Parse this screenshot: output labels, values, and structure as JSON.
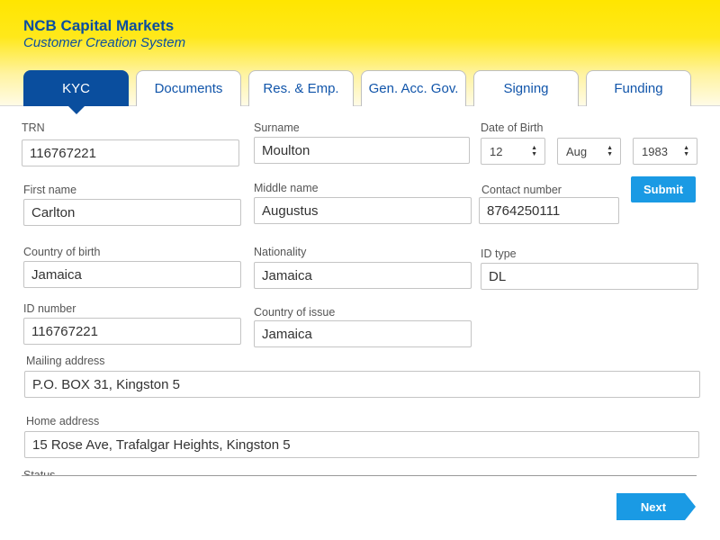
{
  "header": {
    "title": "NCB Capital Markets",
    "subtitle": "Customer Creation System"
  },
  "tabs": [
    {
      "label": "KYC",
      "active": true
    },
    {
      "label": "Documents",
      "active": false
    },
    {
      "label": "Res. & Emp.",
      "active": false
    },
    {
      "label": "Gen. Acc. Gov.",
      "active": false
    },
    {
      "label": "Signing",
      "active": false
    },
    {
      "label": "Funding",
      "active": false
    }
  ],
  "form": {
    "trn": {
      "label": "TRN",
      "value": "116767221"
    },
    "surname": {
      "label": "Surname",
      "value": "Moulton"
    },
    "dob": {
      "label": "Date of Birth",
      "day": "12",
      "month": "Aug",
      "year": "1983"
    },
    "first_name": {
      "label": "First name",
      "value": "Carlton"
    },
    "middle_name": {
      "label": "Middle name",
      "value": "Augustus"
    },
    "contact_number": {
      "label": "Contact number",
      "value": "8764250111"
    },
    "country_of_birth": {
      "label": "Country of birth",
      "value": "Jamaica"
    },
    "nationality": {
      "label": "Nationality",
      "value": "Jamaica"
    },
    "id_type": {
      "label": "ID type",
      "value": "DL"
    },
    "id_number": {
      "label": "ID number",
      "value": "116767221"
    },
    "country_of_issue": {
      "label": "Country of issue",
      "value": "Jamaica"
    },
    "mailing_address": {
      "label": "Mailing address",
      "value": "P.O. BOX 31, Kingston 5"
    },
    "home_address": {
      "label": "Home address",
      "value": "15 Rose Ave, Trafalgar Heights, Kingston 5"
    },
    "status_partial": {
      "label": "Status"
    }
  },
  "actions": {
    "submit_label": "Submit",
    "next_label": "Next"
  },
  "colors": {
    "brand_blue": "#0a4ea0",
    "accent_blue": "#1a9ae4",
    "header_yellow": "#ffe600"
  }
}
